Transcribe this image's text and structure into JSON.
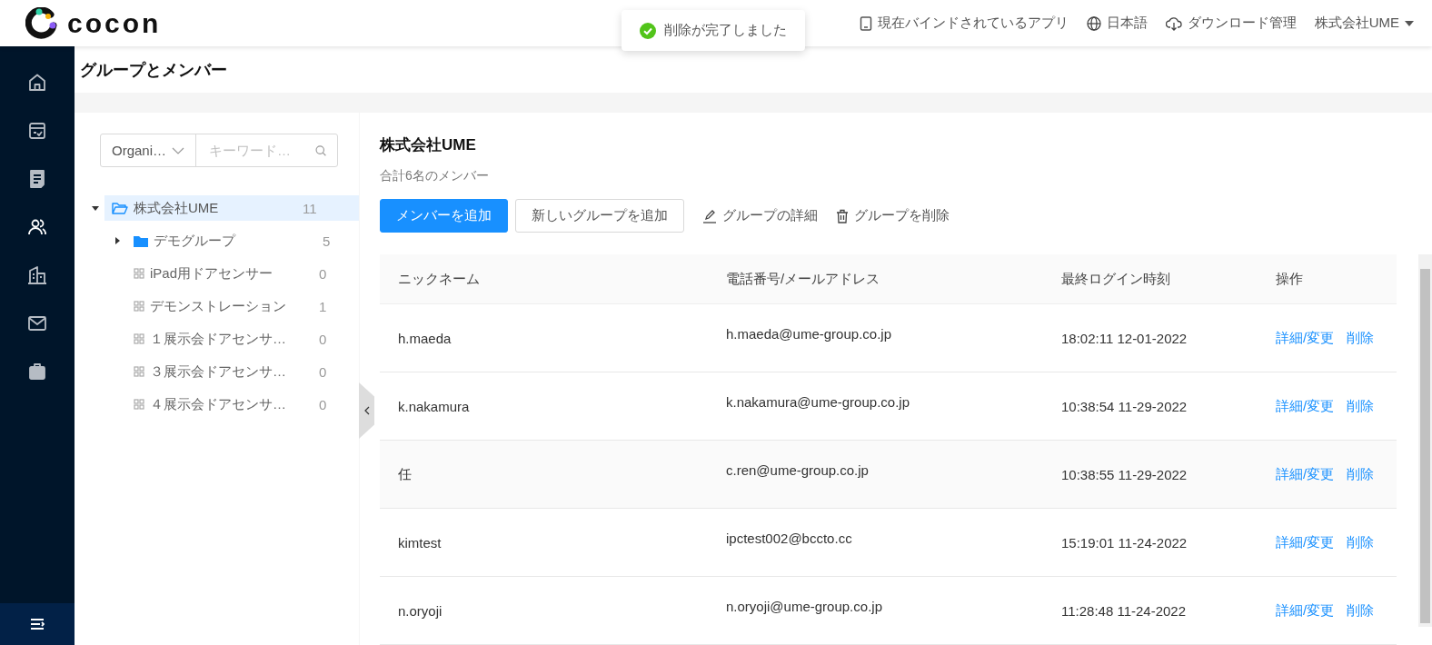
{
  "header": {
    "logo_text": "cocon",
    "links": [
      {
        "label": "現在バインドされているアプリ"
      },
      {
        "label": "日本語"
      },
      {
        "label": "ダウンロード管理"
      }
    ],
    "account": "株式会社UME"
  },
  "toast": {
    "message": "削除が完了しました"
  },
  "nav": [
    {
      "selected": false
    },
    {
      "selected": false
    },
    {
      "selected": false
    },
    {
      "selected": true
    },
    {
      "selected": false
    },
    {
      "selected": false
    },
    {
      "selected": false
    }
  ],
  "page_title": "グループとメンバー",
  "filter": {
    "scope": "Organi…",
    "placeholder": "キーワード…"
  },
  "tree": [
    {
      "label": "株式会社UME",
      "count": "11",
      "kind": "folder",
      "expanded": true,
      "selected": true,
      "children": [
        {
          "label": "デモグループ",
          "count": "5",
          "kind": "folder",
          "expanded": false,
          "selected": false
        },
        {
          "label": "iPad用ドアセンサー",
          "count": "0",
          "kind": "device",
          "selected": false
        },
        {
          "label": "デモンストレーション",
          "count": "1",
          "kind": "device",
          "selected": false
        },
        {
          "label": "１展示会ドアセンサ…",
          "count": "0",
          "kind": "device",
          "selected": false
        },
        {
          "label": "３展示会ドアセンサ…",
          "count": "0",
          "kind": "device",
          "selected": false
        },
        {
          "label": "４展示会ドアセンサ…",
          "count": "0",
          "kind": "device",
          "selected": false
        }
      ]
    }
  ],
  "group": {
    "title": "株式会社UME",
    "summary": "合計6名のメンバー"
  },
  "actions": {
    "primary": "メンバーを追加",
    "secondary": "新しいグループを追加",
    "links": [
      {
        "label": "グループの詳細",
        "kind": "edit"
      },
      {
        "label": "グループを削除",
        "kind": "delete"
      }
    ]
  },
  "table": {
    "columns": [
      "ニックネーム",
      "電話番号/メールアドレス",
      "最終ログイン時刻",
      "操作"
    ],
    "rows": [
      {
        "nickname": "h.maeda",
        "contact": "h.maeda@ume-group.co.jp",
        "last_login": "18:02:11 12-01-2022",
        "actions": [
          "詳細/変更",
          "削除"
        ]
      },
      {
        "nickname": "k.nakamura",
        "contact": "k.nakamura@ume-group.co.jp",
        "last_login": "10:38:54 11-29-2022",
        "actions": [
          "詳細/変更",
          "削除"
        ]
      },
      {
        "nickname": "任",
        "contact": "c.ren@ume-group.co.jp",
        "last_login": "10:38:55 11-29-2022",
        "actions": [
          "詳細/変更",
          "削除"
        ]
      },
      {
        "nickname": "kimtest",
        "contact": "ipctest002@bccto.cc",
        "last_login": "15:19:01 11-24-2022",
        "actions": [
          "詳細/変更",
          "削除"
        ]
      },
      {
        "nickname": "n.oryoji",
        "contact": "n.oryoji@ume-group.co.jp",
        "last_login": "11:28:48 11-24-2022",
        "actions": [
          "詳細/変更",
          "削除"
        ]
      }
    ]
  }
}
